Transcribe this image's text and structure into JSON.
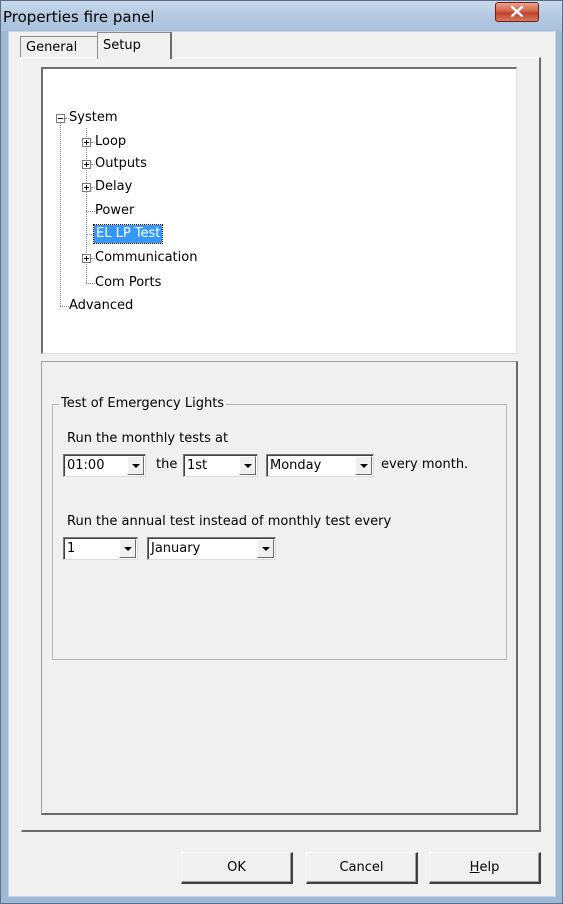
{
  "window": {
    "title": "Properties fire panel",
    "close_label": "x"
  },
  "tabs": [
    {
      "label": "General",
      "active": false
    },
    {
      "label": "Setup",
      "active": true
    }
  ],
  "tree": {
    "root": "System",
    "items": [
      {
        "label": "Loop",
        "expandable": true
      },
      {
        "label": "Outputs",
        "expandable": true
      },
      {
        "label": "Delay",
        "expandable": true
      },
      {
        "label": "Power",
        "expandable": false
      },
      {
        "label": "EL LP Test",
        "expandable": false,
        "selected": true
      },
      {
        "label": "Communication",
        "expandable": true
      },
      {
        "label": "Com Ports",
        "expandable": false
      }
    ],
    "advanced": "Advanced"
  },
  "group": {
    "title": "Test of Emergency Lights",
    "monthly_label": "Run the monthly tests at",
    "time_value": "01:00",
    "the_label": "the",
    "ordinal_value": "1st",
    "weekday_value": "Monday",
    "every_month_label": "every month.",
    "annual_label": "Run the annual test instead of monthly test every",
    "day_value": "1",
    "month_value": "January"
  },
  "buttons": {
    "ok": "OK",
    "cancel": "Cancel",
    "help_first": "H",
    "help_rest": "elp"
  }
}
